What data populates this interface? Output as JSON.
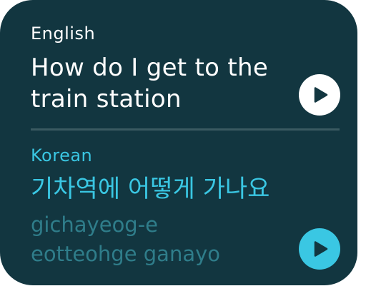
{
  "source": {
    "language": "English",
    "text_lines": [
      "How do I get to the",
      "train station"
    ],
    "play_icon": "play-icon"
  },
  "target": {
    "language": "Korean",
    "text": "기차역에 어떻게 가나요",
    "romanization_lines": [
      "gichayeog-e",
      "eotteohge ganayo"
    ],
    "play_icon": "play-icon"
  },
  "colors": {
    "card_background": "#123640",
    "source_text": "#ffffff",
    "target_accent": "#3ac7e3",
    "romanization": "#2f7d8a",
    "divider": "#3a5a61"
  }
}
